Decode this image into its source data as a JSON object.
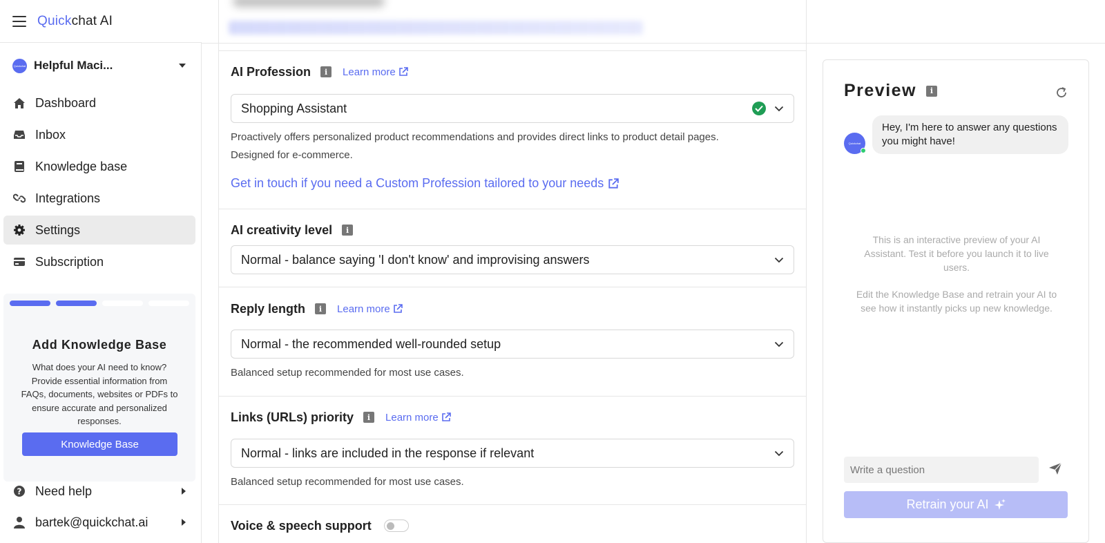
{
  "app": {
    "logo_part1": "Quick",
    "logo_part2": "chat AI"
  },
  "workspace": {
    "name": "Helpful Maci...",
    "avatar_text": "Quickchat"
  },
  "sidebar": {
    "items": [
      {
        "label": "Dashboard",
        "icon": "home-icon"
      },
      {
        "label": "Inbox",
        "icon": "inbox-icon"
      },
      {
        "label": "Knowledge base",
        "icon": "book-icon"
      },
      {
        "label": "Integrations",
        "icon": "link-icon"
      },
      {
        "label": "Settings",
        "icon": "gear-icon",
        "active": true
      },
      {
        "label": "Subscription",
        "icon": "card-icon"
      }
    ],
    "kb_card": {
      "title": "Add Knowledge Base",
      "description": "What does your AI need to know? Provide essential information from FAQs, documents, websites or PDFs to ensure accurate and personalized responses.",
      "button": "Knowledge Base",
      "steps_done": 2,
      "steps_total": 4
    },
    "help": "Need help",
    "user": "bartek@quickchat.ai"
  },
  "settings": {
    "learn_more": "Learn more",
    "profession": {
      "title": "AI Profession",
      "value": "Shopping Assistant",
      "description_line1": "Proactively offers personalized product recommendations and provides direct links to product detail pages.",
      "description_line2": "Designed for e-commerce.",
      "custom_link": "Get in touch if you need a Custom Profession tailored to your needs"
    },
    "creativity": {
      "title": "AI creativity level",
      "value": "Normal - balance saying 'I don't know' and improvising answers"
    },
    "reply_length": {
      "title": "Reply length",
      "value": "Normal - the recommended well-rounded setup",
      "description": "Balanced setup recommended for most use cases."
    },
    "links_priority": {
      "title": "Links (URLs) priority",
      "value": "Normal - links are included in the response if relevant",
      "description": "Balanced setup recommended for most use cases."
    },
    "voice": {
      "title": "Voice & speech support",
      "enabled": false
    }
  },
  "preview": {
    "title": "Preview",
    "avatar_text": "Quickchat",
    "greeting": "Hey, I'm here to answer any questions you might have!",
    "hint1": "This is an interactive preview of your AI Assistant. Test it before you launch it to live users.",
    "hint2": "Edit the Knowledge Base and retrain your AI to see how it instantly picks up new knowledge.",
    "input_placeholder": "Write a question",
    "retrain": "Retrain your AI"
  },
  "colors": {
    "accent": "#5a6cf0",
    "success": "#1f9d55",
    "retrain_disabled": "#b7bdf7"
  }
}
